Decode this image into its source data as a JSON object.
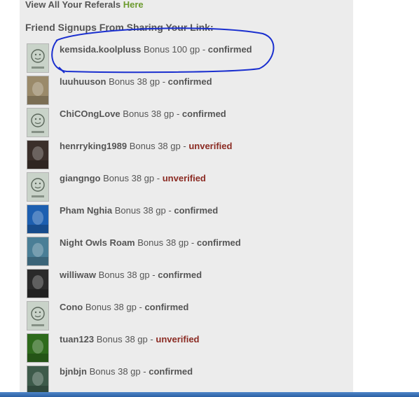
{
  "top": {
    "prefix": "View All Your Referals",
    "link": "Here"
  },
  "section_title": "Friend Signups From Sharing Your Link:",
  "referrals": [
    {
      "name": "kemsida.koolpluss",
      "bonus": "Bonus 100 gp",
      "sep": "-",
      "status": "confirmed",
      "avatar": "no-photo-icon",
      "avatar_color": "#c9d3c9"
    },
    {
      "name": "luuhuuson",
      "bonus": "Bonus 38 gp",
      "sep": "-",
      "status": "confirmed",
      "avatar": "cat-photo",
      "avatar_color": "#9a8a6a"
    },
    {
      "name": "ChiCOngLove",
      "bonus": "Bonus 38 gp",
      "sep": "-",
      "status": "confirmed",
      "avatar": "no-photo-icon",
      "avatar_color": "#c9d3c9"
    },
    {
      "name": "henrryking1989",
      "bonus": "Bonus 38 gp",
      "sep": "-",
      "status": "unverified",
      "avatar": "portrait-photo",
      "avatar_color": "#3a2f2a"
    },
    {
      "name": "giangngo",
      "bonus": "Bonus 38 gp",
      "sep": "-",
      "status": "unverified",
      "avatar": "no-photo-icon",
      "avatar_color": "#c9d3c9"
    },
    {
      "name": "Pham Nghia",
      "bonus": "Bonus 38 gp",
      "sep": "-",
      "status": "confirmed",
      "avatar": "cartoon-photo",
      "avatar_color": "#1d5fb0"
    },
    {
      "name": "Night Owls Roam",
      "bonus": "Bonus 38 gp",
      "sep": "-",
      "status": "confirmed",
      "avatar": "animal-photo",
      "avatar_color": "#4a7e96"
    },
    {
      "name": "williwaw",
      "bonus": "Bonus 38 gp",
      "sep": "-",
      "status": "confirmed",
      "avatar": "face-photo",
      "avatar_color": "#2a2a2a"
    },
    {
      "name": "Cono",
      "bonus": "Bonus 38 gp",
      "sep": "-",
      "status": "confirmed",
      "avatar": "no-photo-icon",
      "avatar_color": "#c9d3c9"
    },
    {
      "name": "tuan123",
      "bonus": "Bonus 38 gp",
      "sep": "-",
      "status": "unverified",
      "avatar": "green-photo",
      "avatar_color": "#2e6a1c"
    },
    {
      "name": "bjnbjn",
      "bonus": "Bonus 38 gp",
      "sep": "-",
      "status": "confirmed",
      "avatar": "landscape-photo",
      "avatar_color": "#3d5a4a"
    }
  ],
  "colors": {
    "confirmed": "#555555",
    "unverified": "#8b2b23",
    "link": "#6b9a2e",
    "annotation": "#1a2fcf"
  }
}
